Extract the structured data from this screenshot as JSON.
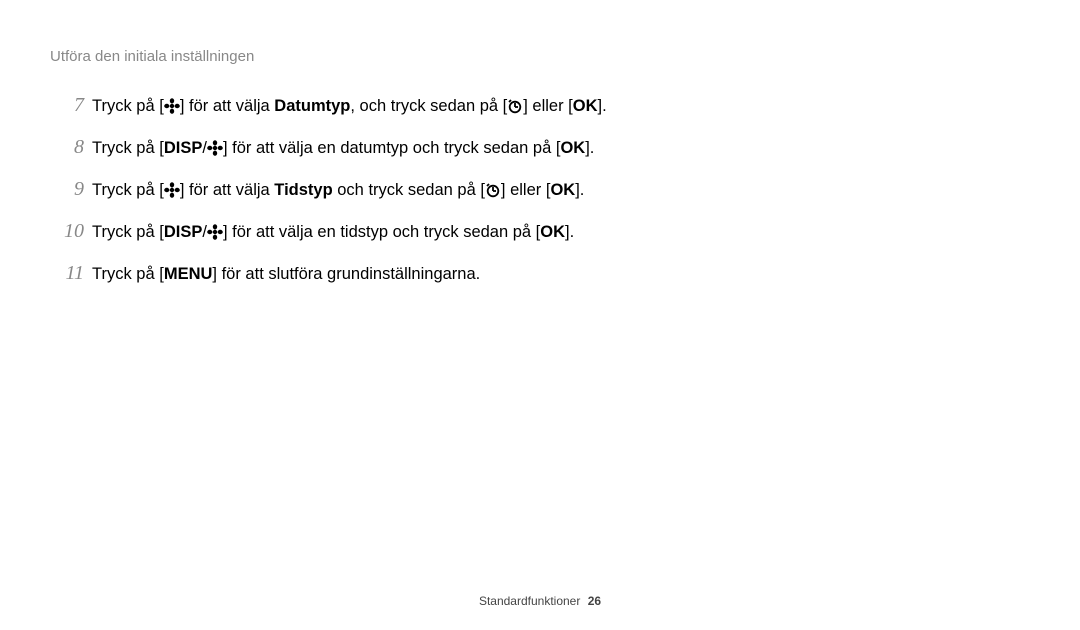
{
  "header": {
    "title": "Utföra den initiala inställningen"
  },
  "steps": {
    "7": {
      "num": "7",
      "t1": "Tryck på [",
      "t2": "] för att välja  ",
      "bold1": "Datumtyp",
      "t3": ", och tryck sedan på [",
      "t4": "] eller [",
      "t5": "]."
    },
    "8": {
      "num": "8",
      "t1": "Tryck på [",
      "t2": "/",
      "t3": "] för att välja en datumtyp och tryck sedan på [",
      "t4": "]."
    },
    "9": {
      "num": "9",
      "t1": "Tryck på [",
      "t2": "] för att välja ",
      "bold1": "Tidstyp",
      "t3": " och tryck sedan på [",
      "t4": "] eller [",
      "t5": "]."
    },
    "10": {
      "num": "10",
      "t1": "Tryck på [",
      "t2": "/",
      "t3": "] för att välja en tidstyp och tryck sedan på [",
      "t4": "]."
    },
    "11": {
      "num": "11",
      "t1": "Tryck på [",
      "t2": "] för att slutföra grundinställningarna."
    }
  },
  "labels": {
    "disp": "DISP",
    "ok": "OK",
    "menu": "MENU"
  },
  "footer": {
    "section": "Standardfunktioner",
    "page": "26"
  }
}
